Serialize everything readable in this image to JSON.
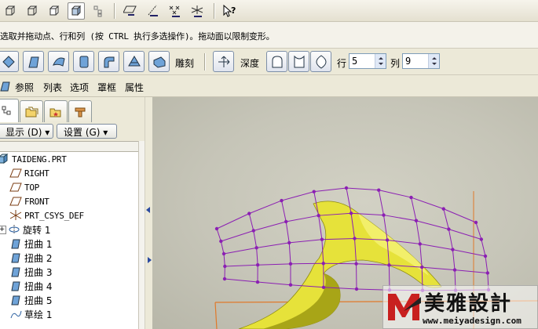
{
  "message": "选取并拖动点、行和列 (按 CTRL 执行多选操作)。拖动面以限制变形。",
  "dashboard": {
    "sculpt_label": "雕刻",
    "depth_label": "深度",
    "row_label": "行",
    "row_value": "5",
    "col_label": "列",
    "col_value": "9"
  },
  "panel_tabs": {
    "references": "参照",
    "list": "列表",
    "options": "选项",
    "frame": "罩框",
    "properties": "属性"
  },
  "left_panel": {
    "display_button": "显示 (D) ▾",
    "settings_button": "设置 (G) ▾"
  },
  "tree": {
    "items": [
      {
        "label": "TAIDENG.PRT",
        "icon": "part-icon"
      },
      {
        "label": "RIGHT",
        "icon": "datum-plane-icon"
      },
      {
        "label": "TOP",
        "icon": "datum-plane-icon"
      },
      {
        "label": "FRONT",
        "icon": "datum-plane-icon"
      },
      {
        "label": "PRT_CSYS_DEF",
        "icon": "csys-icon"
      },
      {
        "label": "旋转 1",
        "icon": "revolve-icon"
      },
      {
        "label": "扭曲 1",
        "icon": "warp-icon"
      },
      {
        "label": "扭曲 2",
        "icon": "warp-icon"
      },
      {
        "label": "扭曲 3",
        "icon": "warp-icon"
      },
      {
        "label": "扭曲 4",
        "icon": "warp-icon"
      },
      {
        "label": "扭曲 5",
        "icon": "warp-icon"
      },
      {
        "label": "草绘 1",
        "icon": "sketch-icon"
      }
    ]
  },
  "watermark": {
    "logo_text": "美雅設計",
    "url": "www.meiyadesign.com"
  },
  "colors": {
    "lattice": "#8b1fb3",
    "surface": "#e6e23a",
    "surface_shade": "#a8a517",
    "orange_curve": "#e0792a",
    "panel_bg": "#ece9d8"
  }
}
